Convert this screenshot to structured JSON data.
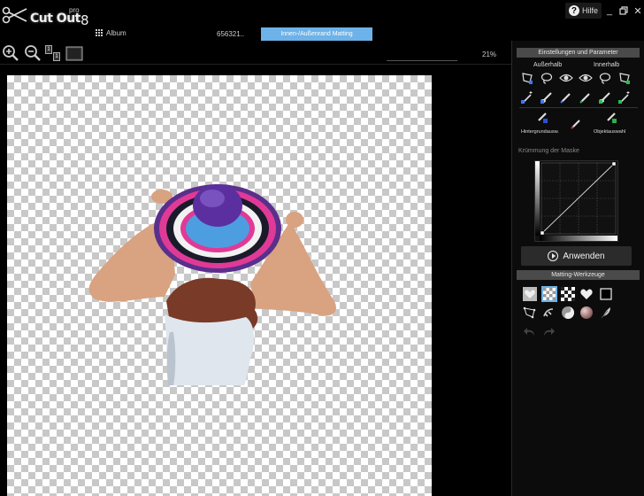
{
  "app": {
    "logo_text": "Cut Out",
    "logo_edition": "pro",
    "logo_version": "8"
  },
  "window": {
    "help_label": "Hilfe",
    "minimize_glyph": "_",
    "restore_glyph": "▫",
    "close_glyph": "✕"
  },
  "tabs": {
    "album_label": "Album",
    "filename": "656321..",
    "mode_tab": "Innen-/Außenrand Matting"
  },
  "toolbar": {
    "zoom_in": "zoom-in-icon",
    "zoom_out": "zoom-out-icon",
    "actual_size": "actual-size-icon",
    "fit_window": "fit-window-icon",
    "zoom_percent": "21%",
    "actual_size_glyph": "1",
    "actual_size_glyph_2": "1"
  },
  "panel": {
    "settings_header": "Einstellungen und Parameter",
    "outside_label": "Außerhalb",
    "inside_label": "Innerhalb",
    "background_select_label": "Hintergrundausw.",
    "object_select_label": "Objektauswahl",
    "curve_label": "Krümmung der Maske",
    "apply_label": "Anwenden",
    "matting_header": "Matting-Werkzeuge"
  },
  "colors": {
    "accent_tab": "#6db2e8",
    "panel_header": "#4a4a4a",
    "outside_marker": "#3a78ff",
    "inside_marker": "#22c24a",
    "bg_select_marker": "#2a4fd8",
    "obj_select_marker": "#2ab04a",
    "red_pencil": "#d83030"
  }
}
